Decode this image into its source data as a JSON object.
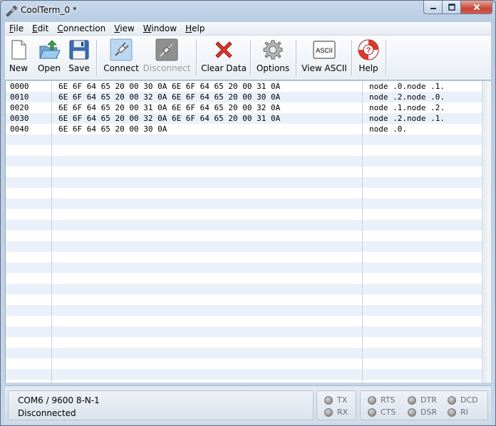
{
  "window": {
    "title": "CoolTerm_0 *"
  },
  "menu": [
    "File",
    "Edit",
    "Connection",
    "View",
    "Window",
    "Help"
  ],
  "toolbar": {
    "new": "New",
    "open": "Open",
    "save": "Save",
    "connect": "Connect",
    "disconnect": "Disconnect",
    "clear": "Clear Data",
    "options": "Options",
    "view_ascii": "View ASCII",
    "view_ascii_icon_text": "ASCII",
    "help": "Help"
  },
  "data_rows": [
    {
      "offset": "0000",
      "hex": "6E 6F 64 65 20 00 30 0A 6E 6F 64 65 20 00 31 0A",
      "ascii": "node .0.node .1."
    },
    {
      "offset": "0010",
      "hex": "6E 6F 64 65 20 00 32 0A 6E 6F 64 65 20 00 30 0A",
      "ascii": "node .2.node .0."
    },
    {
      "offset": "0020",
      "hex": "6E 6F 64 65 20 00 31 0A 6E 6F 64 65 20 00 32 0A",
      "ascii": "node .1.node .2."
    },
    {
      "offset": "0030",
      "hex": "6E 6F 64 65 20 00 32 0A 6E 6F 64 65 20 00 31 0A",
      "ascii": "node .2.node .1."
    },
    {
      "offset": "0040",
      "hex": "6E 6F 64 65 20 00 30 0A",
      "ascii": "node .0."
    }
  ],
  "status": {
    "port": "COM6 / 9600 8-N-1",
    "state": "Disconnected",
    "tx": "TX",
    "rx": "RX",
    "rts": "RTS",
    "cts": "CTS",
    "dtr": "DTR",
    "dsr": "DSR",
    "dcd": "DCD",
    "ri": "RI"
  },
  "colors": {
    "row_alt": "#eaf1fb",
    "led_off": "#8d8d8d",
    "clear_x": "#d9372b",
    "save_blue": "#3a6fb8",
    "open_green": "#3aa24a"
  }
}
